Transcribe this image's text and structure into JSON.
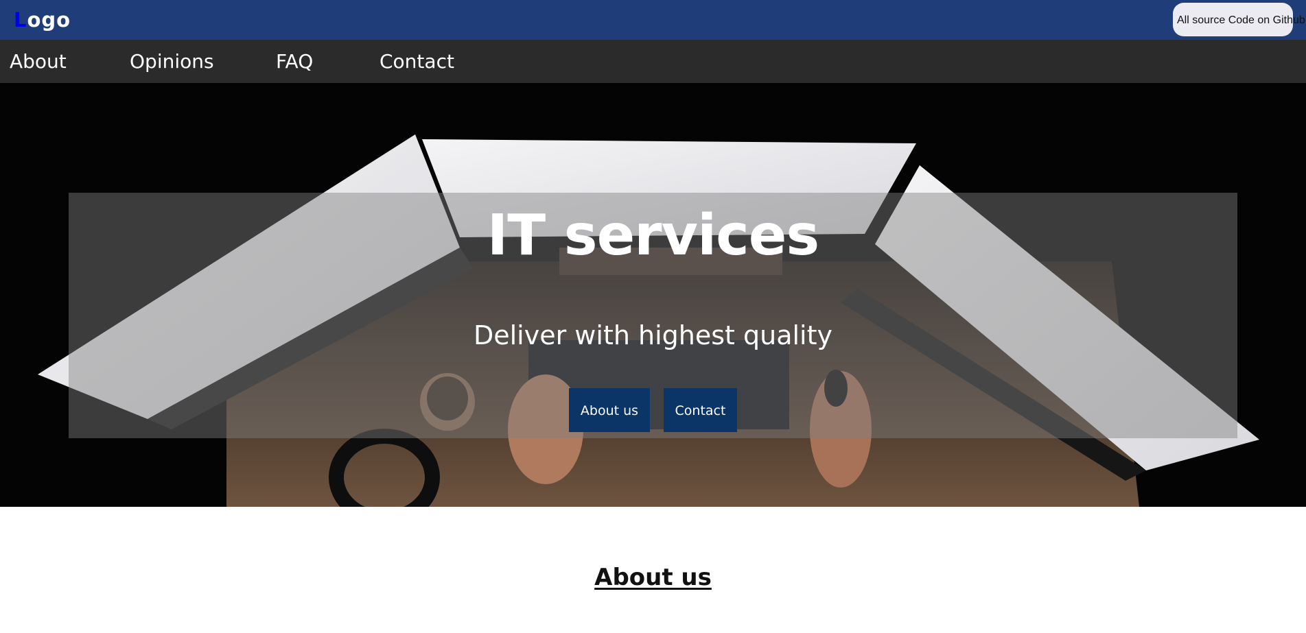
{
  "header": {
    "logo_first_letter": "L",
    "logo_rest": "ogo",
    "github_button_label": "All source Code on Github"
  },
  "nav": {
    "items": [
      {
        "label": "About"
      },
      {
        "label": "Opinions"
      },
      {
        "label": "FAQ"
      },
      {
        "label": "Contact"
      }
    ]
  },
  "hero": {
    "title": "IT services",
    "subtitle": "Deliver with highest quality",
    "buttons": [
      {
        "label": "About us"
      },
      {
        "label": "Contact"
      }
    ]
  },
  "about": {
    "heading": "About us"
  },
  "colors": {
    "header_bg": "#1f3d79",
    "nav_bg": "#2b2b2b",
    "hero_button_bg": "#0a3566",
    "github_button_bg": "#ecebf1",
    "logo_accent": "#0000ee"
  }
}
